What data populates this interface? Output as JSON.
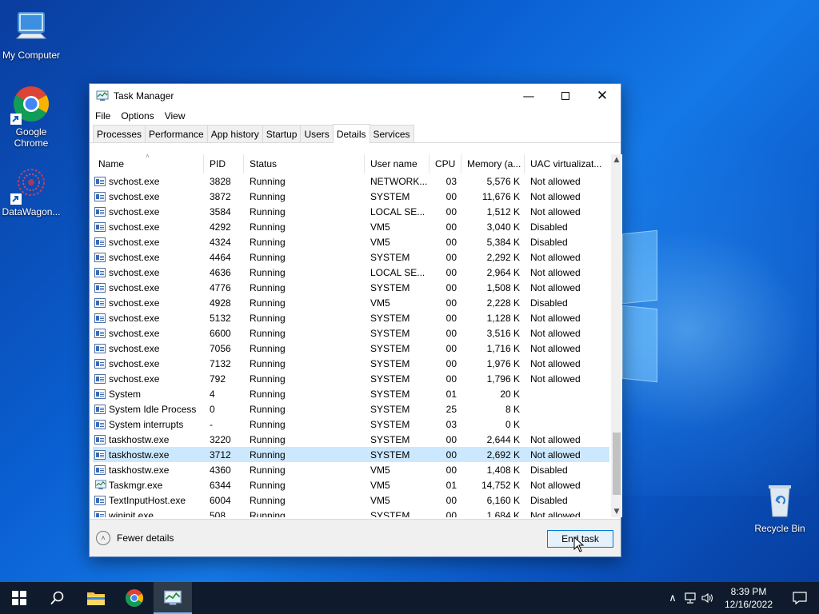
{
  "desktop": {
    "icons": [
      {
        "label": "My Computer"
      },
      {
        "label": "Google Chrome"
      },
      {
        "label": "DataWagon..."
      },
      {
        "label": "Recycle Bin"
      }
    ]
  },
  "window": {
    "title": "Task Manager",
    "menu": [
      "File",
      "Options",
      "View"
    ],
    "tabs": [
      "Processes",
      "Performance",
      "App history",
      "Startup",
      "Users",
      "Details",
      "Services"
    ],
    "active_tab": "Details",
    "columns": [
      "Name",
      "PID",
      "Status",
      "User name",
      "CPU",
      "Memory (a...",
      "UAC virtualizat..."
    ],
    "rows": [
      {
        "name": "svchost.exe",
        "pid": "3828",
        "status": "Running",
        "user": "NETWORK...",
        "cpu": "03",
        "mem": "5,576 K",
        "uac": "Not allowed"
      },
      {
        "name": "svchost.exe",
        "pid": "3872",
        "status": "Running",
        "user": "SYSTEM",
        "cpu": "00",
        "mem": "11,676 K",
        "uac": "Not allowed"
      },
      {
        "name": "svchost.exe",
        "pid": "3584",
        "status": "Running",
        "user": "LOCAL SE...",
        "cpu": "00",
        "mem": "1,512 K",
        "uac": "Not allowed"
      },
      {
        "name": "svchost.exe",
        "pid": "4292",
        "status": "Running",
        "user": "VM5",
        "cpu": "00",
        "mem": "3,040 K",
        "uac": "Disabled"
      },
      {
        "name": "svchost.exe",
        "pid": "4324",
        "status": "Running",
        "user": "VM5",
        "cpu": "00",
        "mem": "5,384 K",
        "uac": "Disabled"
      },
      {
        "name": "svchost.exe",
        "pid": "4464",
        "status": "Running",
        "user": "SYSTEM",
        "cpu": "00",
        "mem": "2,292 K",
        "uac": "Not allowed"
      },
      {
        "name": "svchost.exe",
        "pid": "4636",
        "status": "Running",
        "user": "LOCAL SE...",
        "cpu": "00",
        "mem": "2,964 K",
        "uac": "Not allowed"
      },
      {
        "name": "svchost.exe",
        "pid": "4776",
        "status": "Running",
        "user": "SYSTEM",
        "cpu": "00",
        "mem": "1,508 K",
        "uac": "Not allowed"
      },
      {
        "name": "svchost.exe",
        "pid": "4928",
        "status": "Running",
        "user": "VM5",
        "cpu": "00",
        "mem": "2,228 K",
        "uac": "Disabled"
      },
      {
        "name": "svchost.exe",
        "pid": "5132",
        "status": "Running",
        "user": "SYSTEM",
        "cpu": "00",
        "mem": "1,128 K",
        "uac": "Not allowed"
      },
      {
        "name": "svchost.exe",
        "pid": "6600",
        "status": "Running",
        "user": "SYSTEM",
        "cpu": "00",
        "mem": "3,516 K",
        "uac": "Not allowed"
      },
      {
        "name": "svchost.exe",
        "pid": "7056",
        "status": "Running",
        "user": "SYSTEM",
        "cpu": "00",
        "mem": "1,716 K",
        "uac": "Not allowed"
      },
      {
        "name": "svchost.exe",
        "pid": "7132",
        "status": "Running",
        "user": "SYSTEM",
        "cpu": "00",
        "mem": "1,976 K",
        "uac": "Not allowed"
      },
      {
        "name": "svchost.exe",
        "pid": "792",
        "status": "Running",
        "user": "SYSTEM",
        "cpu": "00",
        "mem": "1,796 K",
        "uac": "Not allowed"
      },
      {
        "name": "System",
        "pid": "4",
        "status": "Running",
        "user": "SYSTEM",
        "cpu": "01",
        "mem": "20 K",
        "uac": ""
      },
      {
        "name": "System Idle Process",
        "pid": "0",
        "status": "Running",
        "user": "SYSTEM",
        "cpu": "25",
        "mem": "8 K",
        "uac": ""
      },
      {
        "name": "System interrupts",
        "pid": "-",
        "status": "Running",
        "user": "SYSTEM",
        "cpu": "03",
        "mem": "0 K",
        "uac": ""
      },
      {
        "name": "taskhostw.exe",
        "pid": "3220",
        "status": "Running",
        "user": "SYSTEM",
        "cpu": "00",
        "mem": "2,644 K",
        "uac": "Not allowed"
      },
      {
        "name": "taskhostw.exe",
        "pid": "3712",
        "status": "Running",
        "user": "SYSTEM",
        "cpu": "00",
        "mem": "2,692 K",
        "uac": "Not allowed",
        "selected": true
      },
      {
        "name": "taskhostw.exe",
        "pid": "4360",
        "status": "Running",
        "user": "VM5",
        "cpu": "00",
        "mem": "1,408 K",
        "uac": "Disabled"
      },
      {
        "name": "Taskmgr.exe",
        "pid": "6344",
        "status": "Running",
        "user": "VM5",
        "cpu": "01",
        "mem": "14,752 K",
        "uac": "Not allowed",
        "icon": "taskmgr"
      },
      {
        "name": "TextInputHost.exe",
        "pid": "6004",
        "status": "Running",
        "user": "VM5",
        "cpu": "00",
        "mem": "6,160 K",
        "uac": "Disabled"
      },
      {
        "name": "wininit.exe",
        "pid": "508",
        "status": "Running",
        "user": "SYSTEM",
        "cpu": "00",
        "mem": "1,684 K",
        "uac": "Not allowed"
      }
    ],
    "footer": {
      "fewer_details": "Fewer details",
      "end_task": "End task"
    }
  },
  "taskbar": {
    "time": "8:39 PM",
    "date": "12/16/2022"
  },
  "colors": {
    "selection": "#cce8ff",
    "accent": "#0078d7",
    "taskbar": "#0f1b2c"
  }
}
